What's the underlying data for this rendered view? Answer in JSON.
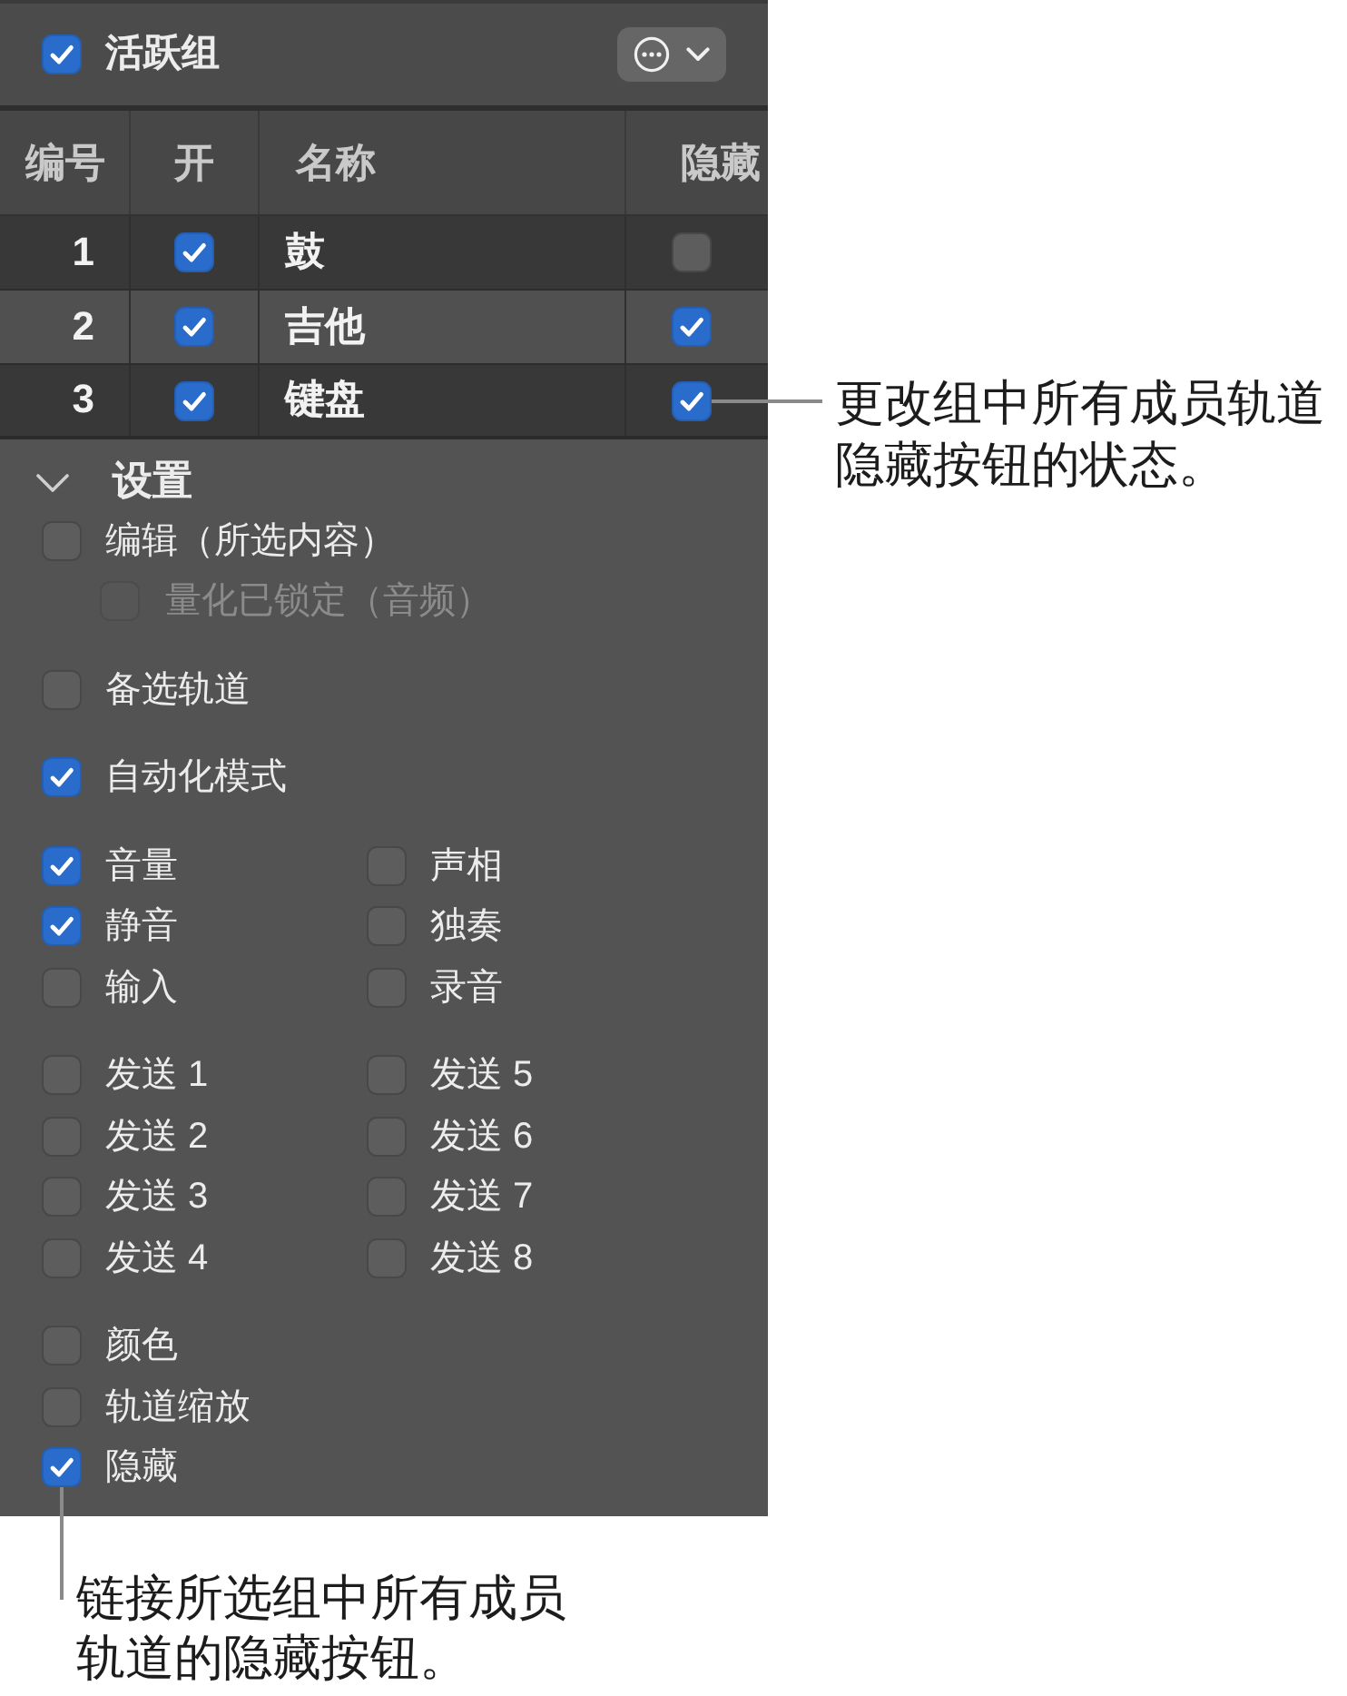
{
  "header": {
    "active_group": {
      "label": "活跃组",
      "checked": true
    }
  },
  "group_table": {
    "columns": [
      "编号",
      "开",
      "名称",
      "隐藏"
    ],
    "rows": [
      {
        "number": "1",
        "on": true,
        "name": "鼓",
        "hidden": false
      },
      {
        "number": "2",
        "on": true,
        "name": "吉他",
        "hidden": true
      },
      {
        "number": "3",
        "on": true,
        "name": "键盘",
        "hidden": true
      }
    ]
  },
  "settings": {
    "title": "设置",
    "expanded": true,
    "groups": [
      {
        "kind": "list",
        "items": [
          {
            "label": "编辑（所选内容）",
            "checked": false,
            "children": [
              {
                "label": "量化已锁定（音频）",
                "checked": false,
                "disabled": true
              }
            ]
          }
        ]
      },
      {
        "kind": "list",
        "items": [
          {
            "label": "备选轨道",
            "checked": false
          }
        ]
      },
      {
        "kind": "list",
        "items": [
          {
            "label": "自动化模式",
            "checked": true
          }
        ]
      },
      {
        "kind": "grid",
        "columns": [
          [
            {
              "label": "音量",
              "checked": true
            },
            {
              "label": "静音",
              "checked": true
            },
            {
              "label": "输入",
              "checked": false
            }
          ],
          [
            {
              "label": "声相",
              "checked": false
            },
            {
              "label": "独奏",
              "checked": false
            },
            {
              "label": "录音",
              "checked": false
            }
          ]
        ]
      },
      {
        "kind": "grid",
        "columns": [
          [
            {
              "label": "发送 1",
              "checked": false
            },
            {
              "label": "发送 2",
              "checked": false
            },
            {
              "label": "发送 3",
              "checked": false
            },
            {
              "label": "发送 4",
              "checked": false
            }
          ],
          [
            {
              "label": "发送 5",
              "checked": false
            },
            {
              "label": "发送 6",
              "checked": false
            },
            {
              "label": "发送 7",
              "checked": false
            },
            {
              "label": "发送 8",
              "checked": false
            }
          ]
        ]
      },
      {
        "kind": "list",
        "items": [
          {
            "label": "颜色",
            "checked": false
          },
          {
            "label": "轨道缩放",
            "checked": false
          },
          {
            "label": "隐藏",
            "checked": true
          }
        ]
      }
    ]
  },
  "callouts": [
    {
      "lines": [
        "更改组中所有成员轨道",
        "隐藏按钮的状态。"
      ]
    },
    {
      "lines": [
        "链接所选组中所有成员",
        "轨道的隐藏按钮。"
      ]
    }
  ]
}
